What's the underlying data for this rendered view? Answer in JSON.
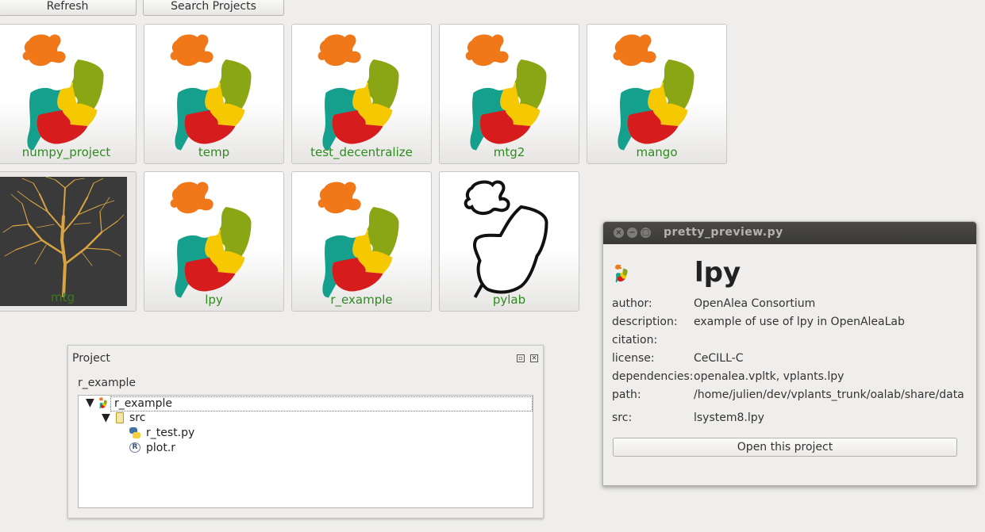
{
  "toolbar": {
    "refresh_label": "Refresh",
    "search_label": "Search Projects"
  },
  "projects": [
    {
      "label": "numpy_project",
      "icon": "openalea-logo-icon"
    },
    {
      "label": "temp",
      "icon": "openalea-logo-icon"
    },
    {
      "label": "test_decentralize",
      "icon": "openalea-logo-icon"
    },
    {
      "label": "mtg2",
      "icon": "openalea-logo-icon"
    },
    {
      "label": "mango",
      "icon": "openalea-logo-icon"
    },
    {
      "label": "mtg",
      "icon": "tree-image"
    },
    {
      "label": "lpy",
      "icon": "openalea-logo-icon"
    },
    {
      "label": "r_example",
      "icon": "openalea-logo-icon"
    },
    {
      "label": "pylab",
      "icon": "openalea-logo-outline-icon"
    }
  ],
  "project_panel": {
    "title": "Project",
    "project_name": "r_example",
    "tree": {
      "root": "r_example",
      "folder": "src",
      "files": [
        "r_test.py",
        "plot.r"
      ]
    }
  },
  "preview": {
    "window_title": "pretty_preview.py",
    "name": "lpy",
    "fields": {
      "author_key": "author:",
      "author": "OpenAlea Consortium",
      "description_key": "description:",
      "description": "example of use of lpy in OpenAleaLab",
      "citation_key": "citation:",
      "citation": "",
      "license_key": "license:",
      "license": "CeCILL-C",
      "dependencies_key": "dependencies:",
      "dependencies": "openalea.vpltk, vplants.lpy",
      "path_key": "path:",
      "path": "/home/julien/dev/vplants_trunk/oalab/share/data",
      "src_key": "src:",
      "src": "lsystem8.lpy"
    },
    "open_label": "Open this project"
  },
  "colors": {
    "label_green": "#2e8b1f",
    "logo_orange": "#f07818",
    "logo_olive": "#8aa614",
    "logo_yellow": "#f6c800",
    "logo_red": "#d61c1c",
    "logo_teal": "#14a08c"
  }
}
